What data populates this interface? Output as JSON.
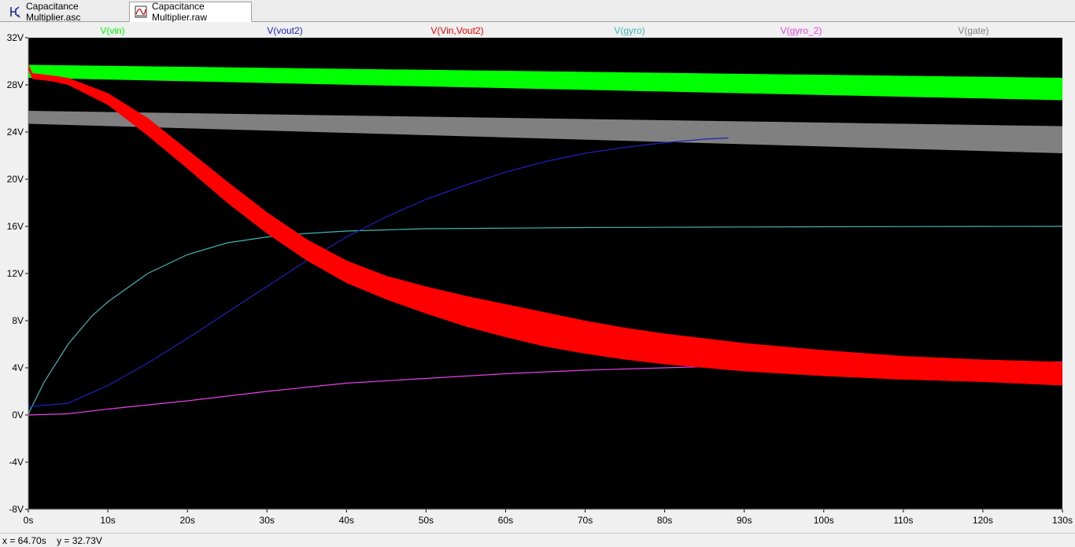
{
  "tabs": [
    {
      "label": "Capacitance Multiplier.asc",
      "icon": "schematic-icon",
      "active": false
    },
    {
      "label": "Capacitance Multiplier.raw",
      "icon": "waveform-icon",
      "active": true
    }
  ],
  "status": {
    "x_readout": "x = 64.70s",
    "y_readout": "y = 32.73V"
  },
  "colors": {
    "plot_background": "#000000",
    "vin": "#00ff00",
    "vout2": "#1f1fbf",
    "vin_vout2": "#ff0000",
    "gyro": "#3fb5b5",
    "gyro_2": "#e93fe9",
    "gate": "#808080"
  },
  "chart_data": {
    "type": "line",
    "xlim": [
      0,
      130
    ],
    "ylim": [
      -8,
      32
    ],
    "x_ticks": [
      "0s",
      "10s",
      "20s",
      "30s",
      "40s",
      "50s",
      "60s",
      "70s",
      "80s",
      "90s",
      "100s",
      "110s",
      "120s",
      "130s"
    ],
    "y_ticks": [
      "32V",
      "28V",
      "24V",
      "20V",
      "16V",
      "12V",
      "8V",
      "4V",
      "0V",
      "-4V",
      "-8V"
    ],
    "grid": false,
    "legend_placement": "top",
    "series": [
      {
        "name": "V(vin)",
        "color": "#00ff00",
        "kind": "band",
        "x": [
          0,
          130
        ],
        "upper": [
          29.7,
          28.6
        ],
        "lower": [
          28.6,
          26.7
        ]
      },
      {
        "name": "V(vout2)",
        "color": "#1f1fbf",
        "kind": "line",
        "x": [
          0,
          5,
          10,
          15,
          20,
          25,
          30,
          35,
          40,
          45,
          50,
          55,
          60,
          65,
          70,
          75,
          80,
          85,
          88
        ],
        "y": [
          0.7,
          1.0,
          2.5,
          4.4,
          6.5,
          8.7,
          10.9,
          13.1,
          15.1,
          16.8,
          18.3,
          19.5,
          20.6,
          21.5,
          22.2,
          22.7,
          23.1,
          23.4,
          23.5
        ]
      },
      {
        "name": "V(Vin,Vout2)",
        "color": "#ff0000",
        "kind": "band",
        "x": [
          0,
          0.5,
          3,
          5,
          10,
          15,
          20,
          25,
          30,
          35,
          40,
          45,
          50,
          55,
          60,
          65,
          70,
          75,
          80,
          85,
          90,
          95,
          100,
          110,
          120,
          130
        ],
        "upper": [
          29.8,
          29.0,
          28.8,
          28.6,
          27.3,
          25.2,
          22.5,
          19.8,
          17.2,
          14.9,
          13.1,
          11.8,
          10.9,
          10.1,
          9.4,
          8.7,
          8.0,
          7.4,
          6.9,
          6.5,
          6.1,
          5.8,
          5.5,
          5.0,
          4.7,
          4.5
        ],
        "lower": [
          29.3,
          28.5,
          28.3,
          28.0,
          26.3,
          23.7,
          20.9,
          18.0,
          15.4,
          13.1,
          11.2,
          9.8,
          8.6,
          7.5,
          6.6,
          5.8,
          5.2,
          4.7,
          4.3,
          4.0,
          3.7,
          3.5,
          3.3,
          3.0,
          2.8,
          2.5
        ]
      },
      {
        "name": "V(gyro)",
        "color": "#3fb5b5",
        "kind": "line",
        "x": [
          0,
          2,
          5,
          8,
          10,
          15,
          20,
          25,
          30,
          35,
          40,
          45,
          50,
          60,
          70,
          80,
          90,
          100,
          110,
          120,
          130
        ],
        "y": [
          0.1,
          2.8,
          6.0,
          8.4,
          9.6,
          12.0,
          13.6,
          14.6,
          15.1,
          15.4,
          15.6,
          15.7,
          15.8,
          15.85,
          15.9,
          15.92,
          15.95,
          15.97,
          15.98,
          15.99,
          16.0
        ]
      },
      {
        "name": "V(gyro_2)",
        "color": "#e93fe9",
        "kind": "line",
        "x": [
          0,
          5,
          10,
          20,
          30,
          40,
          50,
          60,
          70,
          80,
          90,
          100,
          110,
          120,
          130
        ],
        "y": [
          0.0,
          0.1,
          0.5,
          1.2,
          2.0,
          2.7,
          3.1,
          3.5,
          3.8,
          4.0,
          4.2,
          4.3,
          4.4,
          4.45,
          4.5
        ]
      },
      {
        "name": "V(gate)",
        "color": "#808080",
        "kind": "band",
        "x": [
          0,
          130
        ],
        "upper": [
          25.8,
          24.5
        ],
        "lower": [
          24.7,
          22.2
        ]
      }
    ]
  }
}
